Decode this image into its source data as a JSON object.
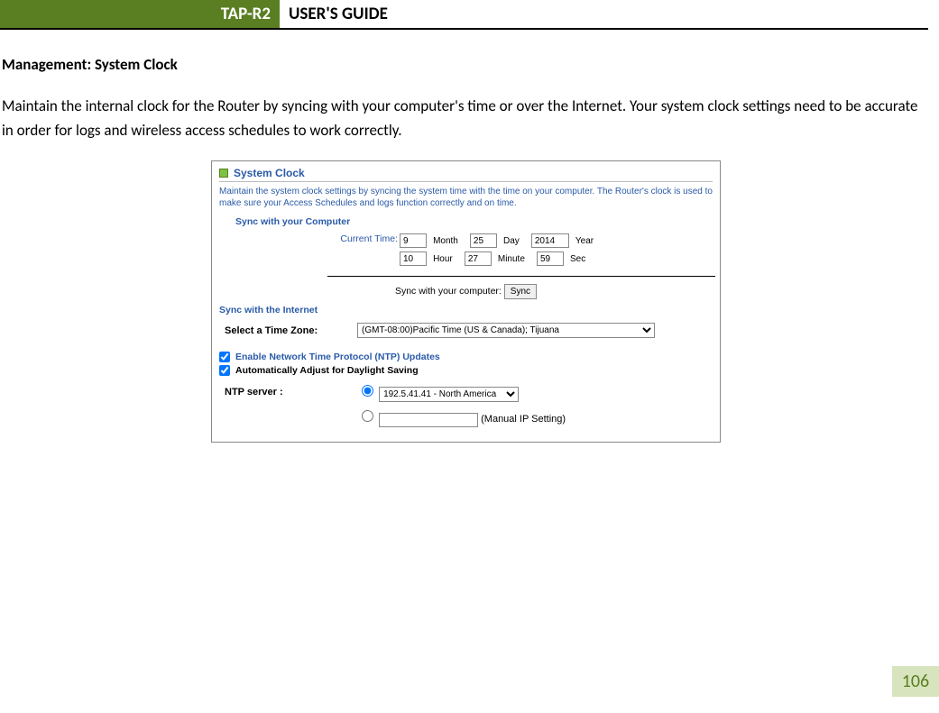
{
  "header": {
    "brand": "TAP-R2",
    "title": "USER'S GUIDE"
  },
  "page": {
    "section_heading": "Management: System Clock",
    "body_text": "Maintain the internal clock for the Router by syncing with your computer's time or over the Internet. Your system clock settings need to be accurate in order for logs and wireless access schedules to work correctly.",
    "page_number": "106"
  },
  "panel": {
    "title": "System Clock",
    "description": "Maintain the system clock settings by syncing the system time with the time on your computer. The Router's clock is used to make sure your Access Schedules and logs function correctly and on time.",
    "sync_computer_heading": "Sync with your Computer",
    "current_time_label": "Current Time:",
    "date": {
      "month": "9",
      "month_label": "Month",
      "day": "25",
      "day_label": "Day",
      "year": "2014",
      "year_label": "Year"
    },
    "time": {
      "hour": "10",
      "hour_label": "Hour",
      "minute": "27",
      "minute_label": "Minute",
      "second": "59",
      "second_label": "Sec"
    },
    "sync_prompt": "Sync with your computer:",
    "sync_button": "Sync",
    "sync_internet_heading": "Sync with the Internet",
    "timezone_label": "Select a Time Zone:",
    "timezone_value": "(GMT-08:00)Pacific Time (US & Canada); Tijuana",
    "ntp_enable_label": "Enable Network Time Protocol (NTP) Updates",
    "dst_label": "Automatically Adjust for Daylight Saving",
    "ntp_server_label": "NTP server :",
    "ntp_selected": "192.5.41.41 - North America",
    "manual_ip_label": "(Manual IP Setting)"
  }
}
